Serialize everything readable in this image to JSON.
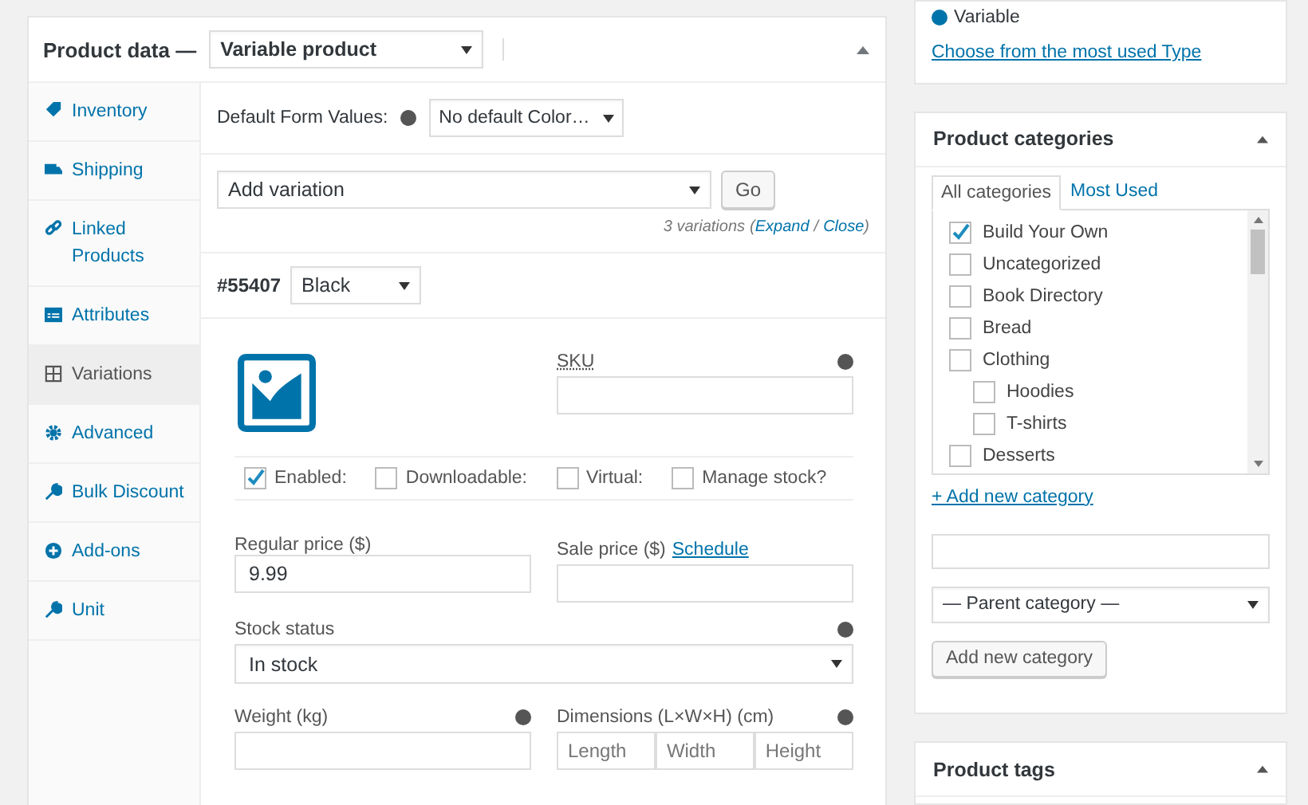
{
  "product_data": {
    "title": "Product data —",
    "type_select": "Variable product",
    "tabs": [
      {
        "label": "Inventory",
        "selected": false
      },
      {
        "label": "Shipping",
        "selected": false
      },
      {
        "label": "Linked Products",
        "selected": false
      },
      {
        "label": "Attributes",
        "selected": false
      },
      {
        "label": "Variations",
        "selected": true
      },
      {
        "label": "Advanced",
        "selected": false
      },
      {
        "label": "Bulk Discount",
        "selected": false
      },
      {
        "label": "Add-ons",
        "selected": false
      },
      {
        "label": "Unit",
        "selected": false
      }
    ],
    "default_form_values": {
      "label": "Default Form Values:",
      "select": "No default Color…"
    },
    "add_variation": {
      "select": "Add variation",
      "button": "Go",
      "count": "3 variations",
      "opening_paren": "(",
      "expand": "Expand",
      "separator": "/",
      "close": "Close",
      "closing_paren": ")"
    },
    "variation": {
      "id": "#55407",
      "color_select": "Black",
      "sku_label": "SKU",
      "options": [
        {
          "label": "Enabled:",
          "checked": true
        },
        {
          "label": "Downloadable:",
          "checked": false
        },
        {
          "label": "Virtual:",
          "checked": false
        },
        {
          "label": "Manage stock?",
          "checked": false
        }
      ],
      "regular_price_label": "Regular price ($)",
      "regular_price": "9.99",
      "sale_price_label": "Sale price ($)",
      "schedule_link": "Schedule",
      "stock_status_label": "Stock status",
      "stock_status": "In stock",
      "weight_label": "Weight (kg)",
      "dimensions_label": "Dimensions (L×W×H) (cm)",
      "dimension_placeholders": [
        "Length",
        "Width",
        "Height"
      ]
    }
  },
  "product_type_box": {
    "option": "Variable",
    "link": "Choose from the most used Type"
  },
  "product_categories": {
    "title": "Product categories",
    "tabs": [
      {
        "label": "All categories",
        "selected": true
      },
      {
        "label": "Most Used",
        "selected": false
      }
    ],
    "items": [
      {
        "label": "Build Your Own",
        "checked": true
      },
      {
        "label": "Uncategorized",
        "checked": false
      },
      {
        "label": "Book Directory",
        "checked": false
      },
      {
        "label": "Bread",
        "checked": false
      },
      {
        "label": "Clothing",
        "checked": false,
        "children": [
          {
            "label": "Hoodies",
            "checked": false
          },
          {
            "label": "T-shirts",
            "checked": false
          }
        ]
      },
      {
        "label": "Desserts",
        "checked": false
      }
    ],
    "add_link": "+ Add new category",
    "parent_select": "— Parent category —",
    "add_button": "Add new category"
  },
  "product_tags": {
    "title": "Product tags"
  }
}
